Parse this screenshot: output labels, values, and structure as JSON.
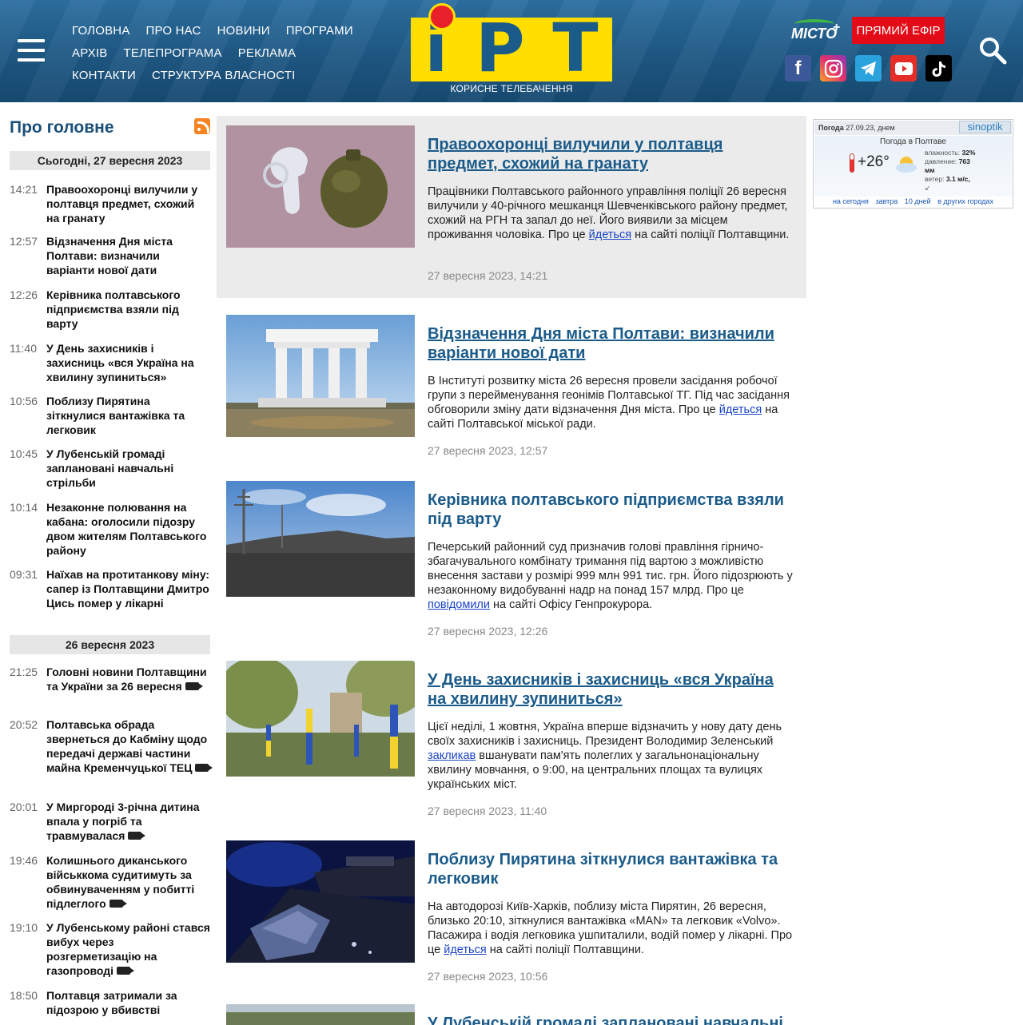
{
  "header": {
    "nav_rows": [
      [
        "ГОЛОВНА",
        "ПРО НАС",
        "НОВИНИ",
        "ПРОГРАМИ"
      ],
      [
        "АРХІВ",
        "ТЕЛЕПРОГРАМА",
        "РЕКЛАМА"
      ],
      [
        "КОНТАКТИ",
        "СТРУКТУРА ВЛАСНОСТІ"
      ]
    ],
    "logo_subtitle": "КОРИСНЕ ТЕЛЕБАЧЕННЯ",
    "misto_label": "МІСТО",
    "live_button": "ПРЯМИЙ ЕФІР",
    "socials": [
      "facebook",
      "instagram",
      "telegram",
      "youtube",
      "tiktok"
    ]
  },
  "sidebar": {
    "title": "Про головне",
    "days": [
      {
        "label": "Сьогодні, 27 вересня 2023",
        "items": [
          {
            "time": "14:21",
            "title": "Правоохоронці вилучили у полтавця предмет, схожий на гранату",
            "video": false
          },
          {
            "time": "12:57",
            "title": "Відзначення Дня міста Полтави: визначили варіанти нової дати",
            "video": false
          },
          {
            "time": "12:26",
            "title": "Керівника полтавського підприємства взяли під варту",
            "video": false
          },
          {
            "time": "11:40",
            "title": "У День захисників і захисниць «вся Україна на хвилину зупиниться»",
            "video": false
          },
          {
            "time": "10:56",
            "title": "Поблизу Пирятина зіткнулися вантажівка та легковик",
            "video": false
          },
          {
            "time": "10:45",
            "title": "У Лубенській громаді заплановані навчальні стрільби",
            "video": false
          },
          {
            "time": "10:14",
            "title": "Незаконне полювання на кабана: оголосили підозру двом жителям Полтавського району",
            "video": false
          },
          {
            "time": "09:31",
            "title": "Наїхав на протитанкову міну: сапер із Полтавщини Дмитро Цись помер у лікарні",
            "video": false
          }
        ]
      },
      {
        "label": "26 вересня 2023",
        "items": [
          {
            "time": "21:25",
            "title": "Головні новини Полтавщини та України за 26 вересня",
            "video": true
          },
          {
            "time": "20:52",
            "title": "Полтавська обрада звернеться до Кабміну щодо передачі державі частини майна Кременчуцької ТЕЦ",
            "video": true
          },
          {
            "time": "20:01",
            "title": "У Миргороді 3-річна дитина впала у погріб та травмувалася",
            "video": true
          },
          {
            "time": "19:46",
            "title": "Колишнього диканського військкома судитимуть за обвинуваченням у побитті підлеглого",
            "video": true
          },
          {
            "time": "19:10",
            "title": "У Лубенському районі стався вибух через розгерметизацію на газопроводі",
            "video": true
          },
          {
            "time": "18:50",
            "title": "Полтавця затримали за підозрою у вбивстві",
            "video": false
          }
        ]
      }
    ]
  },
  "articles": [
    {
      "title": "Правоохоронці вилучили у полтавця предмет, схожий на гранату",
      "text_before": "Працівники Полтавського районного управління поліції 26 вересня вилучили у 40-річного мешканця Шевченківського району предмет, схожий на РГН та запал до неї. Його виявили за місцем проживання чоловіка. Про це ",
      "link": "йдеться",
      "text_after": " на сайті поліції Полтавщини.",
      "date": "27 вересня 2023, 14:21"
    },
    {
      "title": "Відзначення Дня міста Полтави: визначили варіанти нової дати",
      "text_before": "В Інституті розвитку міста 26 вересня провели засідання робочої групи з перейменування геонімів Полтавської ТГ. Під час засідання обговорили зміну дати відзначення Дня міста. Про це ",
      "link": "йдеться",
      "text_after": " на сайті Полтавської міської ради.",
      "date": "27 вересня 2023, 12:57"
    },
    {
      "title": "Керівника полтавського підприємства взяли під варту",
      "text_before": "Печерський районний суд призначив голові правління гірничо-збагачувального комбінату тримання під вартою з можливістю внесення застави у розмірі 999 млн 991 тис. грн. Його підозрюють у незаконному видобуванні надр на понад 157 млрд. Про це ",
      "link": "повідомили",
      "text_after": " на сайті Офісу Генпрокурора.",
      "date": "27 вересня 2023, 12:26"
    },
    {
      "title": "У День захисників і захисниць «вся Україна на хвилину зупиниться»",
      "text_before": "Цієї неділі, 1 жовтня, Україна вперше відзначить у нову дату день своїх захисників і захисниць. Президент Володимир Зеленський ",
      "link": "закликав",
      "text_after": " вшанувати пам'ять полеглих у загальнонаціональну хвилину мовчання, о 9:00, на центральних площах та вулицях українських міст.",
      "date": "27 вересня 2023, 11:40"
    },
    {
      "title": "Поблизу Пирятина зіткнулися вантажівка та легковик",
      "text_before": "На автодорозі Київ-Харків, поблизу міста Пирятин, 26 вересня, близько 20:10, зіткнулися вантажівка «MAN» та легковик «Volvo». Пасажира і водія легковика ушпиталили, водій помер у лікарні. Про це ",
      "link": "йдеться",
      "text_after": " на сайті поліції Полтавщини.",
      "date": "27 вересня 2023, 10:56"
    },
    {
      "title": "У Лубенській громаді заплановані навчальні стрільби",
      "text_before": "",
      "link": "",
      "text_after": "",
      "date": ""
    }
  ],
  "weather": {
    "head_label": "Погода",
    "head_date": "27.09.23, днем",
    "logo": "sinoptik",
    "city": "Погода в Полтаве",
    "temp": "+26°",
    "humidity_label": "влажность:",
    "humidity": "32%",
    "pressure_label": "давление:",
    "pressure": "763",
    "pressure_unit": "мм",
    "wind_label": "ветер:",
    "wind": "3.1 м/с,",
    "links": [
      "на сегодня",
      "завтра",
      "10 дней",
      "в других городах"
    ]
  },
  "colors": {
    "header_bg": "#1f5a86",
    "logo_yellow": "#ffde00",
    "logo_red": "#e8202a",
    "live_red": "#e30b17",
    "title_blue": "#1b5b8a"
  }
}
